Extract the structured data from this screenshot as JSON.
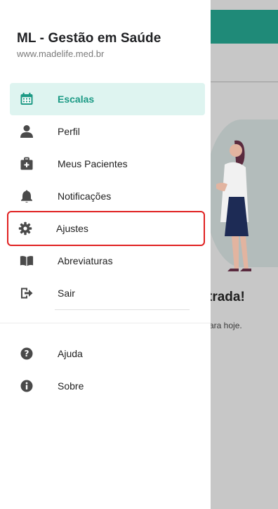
{
  "app": {
    "title": "ML - Gestão em Saúde",
    "url": "www.madelife.med.br"
  },
  "menu_main": [
    {
      "label": "Escalas",
      "icon": "calendar-icon",
      "active": true
    },
    {
      "label": "Perfil",
      "icon": "person-icon"
    },
    {
      "label": "Meus Pacientes",
      "icon": "medical-kit-icon"
    },
    {
      "label": "Notificações",
      "icon": "bell-icon"
    },
    {
      "label": "Ajustes",
      "icon": "gear-icon",
      "highlighted": true
    },
    {
      "label": "Abreviaturas",
      "icon": "book-icon"
    },
    {
      "label": "Sair",
      "icon": "logout-icon"
    }
  ],
  "menu_secondary": [
    {
      "label": "Ajuda",
      "icon": "help-icon"
    },
    {
      "label": "Sobre",
      "icon": "info-icon"
    }
  ],
  "background": {
    "title_fragment": "trada!",
    "subtitle_fragment": "ara hoje."
  },
  "colors": {
    "accent": "#1c9a85",
    "appbar": "#1f8a78",
    "active_bg": "#def4f0",
    "highlight_border": "#e02020",
    "icon": "#4a4a4a"
  }
}
